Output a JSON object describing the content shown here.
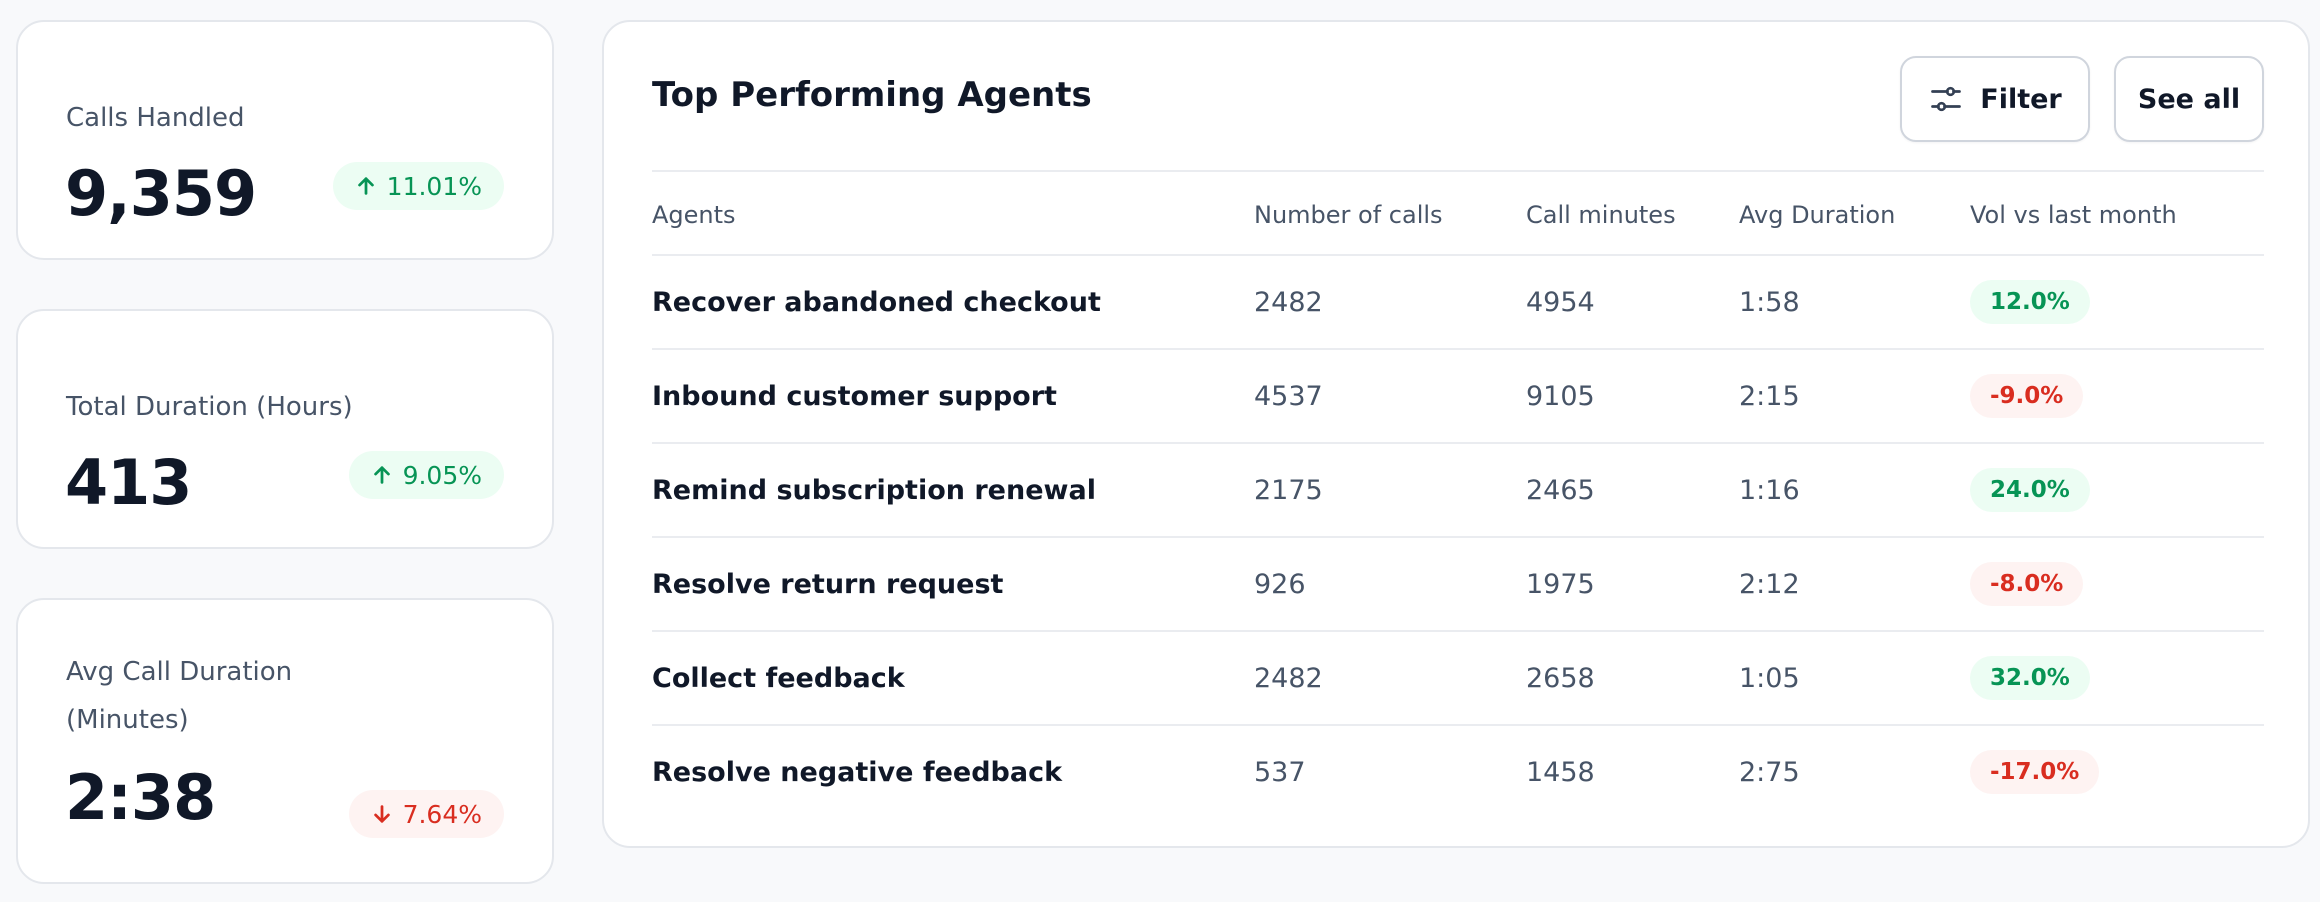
{
  "stats": [
    {
      "label": "Calls Handled",
      "value": "9,359",
      "change": "11.01%",
      "direction": "up"
    },
    {
      "label": "Total Duration (Hours)",
      "value": "413",
      "change": "9.05%",
      "direction": "up"
    },
    {
      "label_line1": "Avg Call Duration",
      "label_line2": "(Minutes)",
      "value": "2:38",
      "change": "7.64%",
      "direction": "down"
    }
  ],
  "panel": {
    "title": "Top Performing Agents",
    "filter_label": "Filter",
    "filter_icon": "sliders-icon",
    "see_all_label": "See all"
  },
  "table": {
    "headers": [
      "Agents",
      "Number of calls",
      "Call minutes",
      "Avg Duration",
      "Vol vs last month"
    ],
    "rows": [
      {
        "agent": "Recover abandoned checkout",
        "calls": "2482",
        "minutes": "4954",
        "avg": "1:58",
        "vol": "12.0%",
        "trend": "up"
      },
      {
        "agent": "Inbound customer support",
        "calls": "4537",
        "minutes": "9105",
        "avg": "2:15",
        "vol": "-9.0%",
        "trend": "down"
      },
      {
        "agent": "Remind subscription renewal",
        "calls": "2175",
        "minutes": "2465",
        "avg": "1:16",
        "vol": "24.0%",
        "trend": "up"
      },
      {
        "agent": "Resolve return request",
        "calls": "926",
        "minutes": "1975",
        "avg": "2:12",
        "vol": "-8.0%",
        "trend": "down"
      },
      {
        "agent": "Collect feedback",
        "calls": "2482",
        "minutes": "2658",
        "avg": "1:05",
        "vol": "32.0%",
        "trend": "up"
      },
      {
        "agent": "Resolve negative feedback",
        "calls": "537",
        "minutes": "1458",
        "avg": "2:75",
        "vol": "-17.0%",
        "trend": "down"
      }
    ]
  },
  "colors": {
    "positive": "#079455",
    "positive_bg": "#ecfdf3",
    "negative": "#d92d20",
    "negative_bg": "#fef3f2"
  }
}
